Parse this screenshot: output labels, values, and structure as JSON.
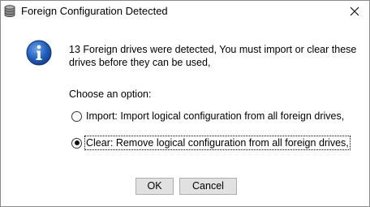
{
  "window": {
    "title": "Foreign Configuration Detected",
    "title_icon": "database-icon",
    "close_icon": "close-icon"
  },
  "message": {
    "icon": "info-icon",
    "text": "13 Foreign drives were detected, You must import or clear these drives before they can be used,"
  },
  "options": {
    "prompt": "Choose an option:",
    "items": [
      {
        "label": "Import: Import logical configuration from all foreign drives,",
        "selected": false
      },
      {
        "label": "Clear: Remove logical configuration from all foreign drives,",
        "selected": true
      }
    ]
  },
  "buttons": {
    "ok_label": "OK",
    "cancel_label": "Cancel"
  },
  "colors": {
    "info_icon_blue": "#1f5fbf",
    "button_face": "#e1e1e1",
    "button_border": "#adadad"
  }
}
